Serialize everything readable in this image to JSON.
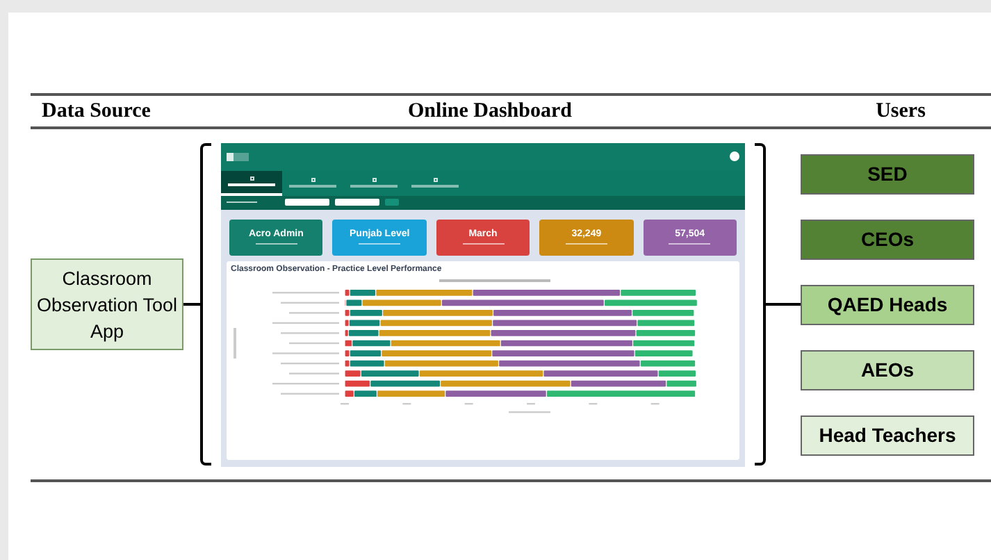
{
  "header": {
    "columns": [
      "Data Source",
      "Online Dashboard",
      "Users"
    ]
  },
  "data_source": {
    "label": "Classroom Observation Tool App"
  },
  "dashboard": {
    "tabs": [
      {
        "selected": true
      },
      {
        "selected": false
      },
      {
        "selected": false
      },
      {
        "selected": false
      }
    ],
    "kpis": [
      {
        "value": "Acro Admin",
        "color": "#14806d"
      },
      {
        "value": "Punjab Level",
        "color": "#1aa3d9"
      },
      {
        "value": "March",
        "color": "#d9433f"
      },
      {
        "value": "32,249",
        "color": "#cc8a12"
      },
      {
        "value": "57,504",
        "color": "#9462a6"
      }
    ],
    "panel": {
      "title": "Classroom Observation - Practice Level Performance"
    }
  },
  "users": [
    {
      "label": "SED",
      "color": "#548235"
    },
    {
      "label": "CEOs",
      "color": "#548235"
    },
    {
      "label": "QAED Heads",
      "color": "#a9d18e"
    },
    {
      "label": "AEOs",
      "color": "#c5e0b4"
    },
    {
      "label": "Head Teachers",
      "color": "#e2efda"
    }
  ]
}
